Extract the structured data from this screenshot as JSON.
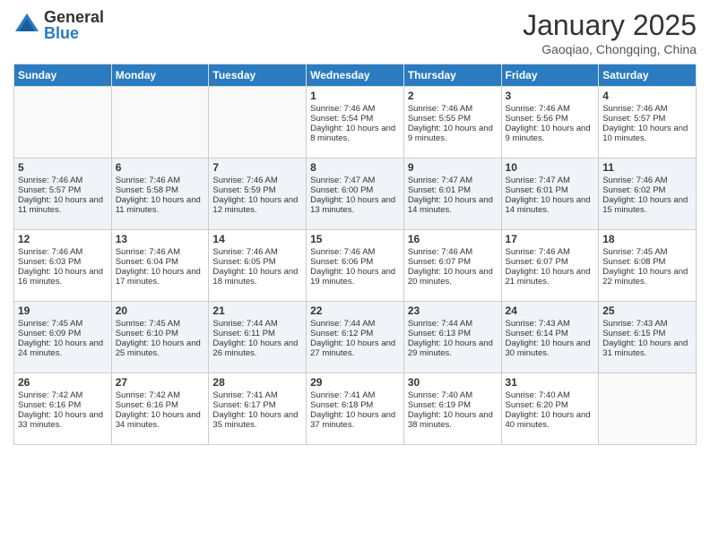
{
  "logo": {
    "general": "General",
    "blue": "Blue"
  },
  "title": "January 2025",
  "subtitle": "Gaoqiao, Chongqing, China",
  "days": [
    "Sunday",
    "Monday",
    "Tuesday",
    "Wednesday",
    "Thursday",
    "Friday",
    "Saturday"
  ],
  "weeks": [
    [
      {
        "num": "",
        "sunrise": "",
        "sunset": "",
        "daylight": ""
      },
      {
        "num": "",
        "sunrise": "",
        "sunset": "",
        "daylight": ""
      },
      {
        "num": "",
        "sunrise": "",
        "sunset": "",
        "daylight": ""
      },
      {
        "num": "1",
        "sunrise": "Sunrise: 7:46 AM",
        "sunset": "Sunset: 5:54 PM",
        "daylight": "Daylight: 10 hours and 8 minutes."
      },
      {
        "num": "2",
        "sunrise": "Sunrise: 7:46 AM",
        "sunset": "Sunset: 5:55 PM",
        "daylight": "Daylight: 10 hours and 9 minutes."
      },
      {
        "num": "3",
        "sunrise": "Sunrise: 7:46 AM",
        "sunset": "Sunset: 5:56 PM",
        "daylight": "Daylight: 10 hours and 9 minutes."
      },
      {
        "num": "4",
        "sunrise": "Sunrise: 7:46 AM",
        "sunset": "Sunset: 5:57 PM",
        "daylight": "Daylight: 10 hours and 10 minutes."
      }
    ],
    [
      {
        "num": "5",
        "sunrise": "Sunrise: 7:46 AM",
        "sunset": "Sunset: 5:57 PM",
        "daylight": "Daylight: 10 hours and 11 minutes."
      },
      {
        "num": "6",
        "sunrise": "Sunrise: 7:46 AM",
        "sunset": "Sunset: 5:58 PM",
        "daylight": "Daylight: 10 hours and 11 minutes."
      },
      {
        "num": "7",
        "sunrise": "Sunrise: 7:46 AM",
        "sunset": "Sunset: 5:59 PM",
        "daylight": "Daylight: 10 hours and 12 minutes."
      },
      {
        "num": "8",
        "sunrise": "Sunrise: 7:47 AM",
        "sunset": "Sunset: 6:00 PM",
        "daylight": "Daylight: 10 hours and 13 minutes."
      },
      {
        "num": "9",
        "sunrise": "Sunrise: 7:47 AM",
        "sunset": "Sunset: 6:01 PM",
        "daylight": "Daylight: 10 hours and 14 minutes."
      },
      {
        "num": "10",
        "sunrise": "Sunrise: 7:47 AM",
        "sunset": "Sunset: 6:01 PM",
        "daylight": "Daylight: 10 hours and 14 minutes."
      },
      {
        "num": "11",
        "sunrise": "Sunrise: 7:46 AM",
        "sunset": "Sunset: 6:02 PM",
        "daylight": "Daylight: 10 hours and 15 minutes."
      }
    ],
    [
      {
        "num": "12",
        "sunrise": "Sunrise: 7:46 AM",
        "sunset": "Sunset: 6:03 PM",
        "daylight": "Daylight: 10 hours and 16 minutes."
      },
      {
        "num": "13",
        "sunrise": "Sunrise: 7:46 AM",
        "sunset": "Sunset: 6:04 PM",
        "daylight": "Daylight: 10 hours and 17 minutes."
      },
      {
        "num": "14",
        "sunrise": "Sunrise: 7:46 AM",
        "sunset": "Sunset: 6:05 PM",
        "daylight": "Daylight: 10 hours and 18 minutes."
      },
      {
        "num": "15",
        "sunrise": "Sunrise: 7:46 AM",
        "sunset": "Sunset: 6:06 PM",
        "daylight": "Daylight: 10 hours and 19 minutes."
      },
      {
        "num": "16",
        "sunrise": "Sunrise: 7:46 AM",
        "sunset": "Sunset: 6:07 PM",
        "daylight": "Daylight: 10 hours and 20 minutes."
      },
      {
        "num": "17",
        "sunrise": "Sunrise: 7:46 AM",
        "sunset": "Sunset: 6:07 PM",
        "daylight": "Daylight: 10 hours and 21 minutes."
      },
      {
        "num": "18",
        "sunrise": "Sunrise: 7:45 AM",
        "sunset": "Sunset: 6:08 PM",
        "daylight": "Daylight: 10 hours and 22 minutes."
      }
    ],
    [
      {
        "num": "19",
        "sunrise": "Sunrise: 7:45 AM",
        "sunset": "Sunset: 6:09 PM",
        "daylight": "Daylight: 10 hours and 24 minutes."
      },
      {
        "num": "20",
        "sunrise": "Sunrise: 7:45 AM",
        "sunset": "Sunset: 6:10 PM",
        "daylight": "Daylight: 10 hours and 25 minutes."
      },
      {
        "num": "21",
        "sunrise": "Sunrise: 7:44 AM",
        "sunset": "Sunset: 6:11 PM",
        "daylight": "Daylight: 10 hours and 26 minutes."
      },
      {
        "num": "22",
        "sunrise": "Sunrise: 7:44 AM",
        "sunset": "Sunset: 6:12 PM",
        "daylight": "Daylight: 10 hours and 27 minutes."
      },
      {
        "num": "23",
        "sunrise": "Sunrise: 7:44 AM",
        "sunset": "Sunset: 6:13 PM",
        "daylight": "Daylight: 10 hours and 29 minutes."
      },
      {
        "num": "24",
        "sunrise": "Sunrise: 7:43 AM",
        "sunset": "Sunset: 6:14 PM",
        "daylight": "Daylight: 10 hours and 30 minutes."
      },
      {
        "num": "25",
        "sunrise": "Sunrise: 7:43 AM",
        "sunset": "Sunset: 6:15 PM",
        "daylight": "Daylight: 10 hours and 31 minutes."
      }
    ],
    [
      {
        "num": "26",
        "sunrise": "Sunrise: 7:42 AM",
        "sunset": "Sunset: 6:16 PM",
        "daylight": "Daylight: 10 hours and 33 minutes."
      },
      {
        "num": "27",
        "sunrise": "Sunrise: 7:42 AM",
        "sunset": "Sunset: 6:16 PM",
        "daylight": "Daylight: 10 hours and 34 minutes."
      },
      {
        "num": "28",
        "sunrise": "Sunrise: 7:41 AM",
        "sunset": "Sunset: 6:17 PM",
        "daylight": "Daylight: 10 hours and 35 minutes."
      },
      {
        "num": "29",
        "sunrise": "Sunrise: 7:41 AM",
        "sunset": "Sunset: 6:18 PM",
        "daylight": "Daylight: 10 hours and 37 minutes."
      },
      {
        "num": "30",
        "sunrise": "Sunrise: 7:40 AM",
        "sunset": "Sunset: 6:19 PM",
        "daylight": "Daylight: 10 hours and 38 minutes."
      },
      {
        "num": "31",
        "sunrise": "Sunrise: 7:40 AM",
        "sunset": "Sunset: 6:20 PM",
        "daylight": "Daylight: 10 hours and 40 minutes."
      },
      {
        "num": "",
        "sunrise": "",
        "sunset": "",
        "daylight": ""
      }
    ]
  ]
}
